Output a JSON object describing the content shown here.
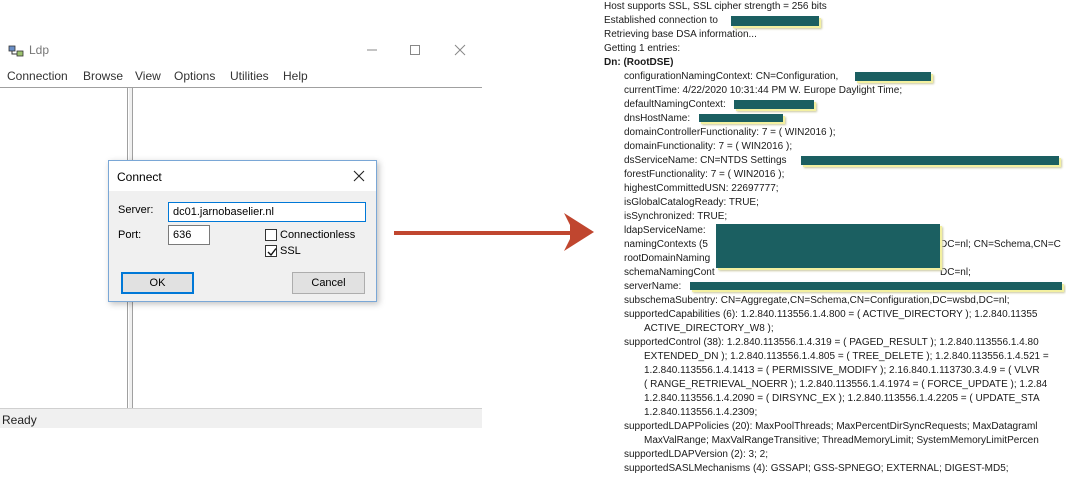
{
  "window": {
    "title": "Ldp",
    "menu": [
      "Connection",
      "Browse",
      "View",
      "Options",
      "Utilities",
      "Help"
    ],
    "status": "Ready"
  },
  "dialog": {
    "title": "Connect",
    "server_label": "Server:",
    "server_value": "dc01.jarnobaselier.nl",
    "port_label": "Port:",
    "port_value": "636",
    "connectionless_label": "Connectionless",
    "connectionless_checked": false,
    "ssl_label": "SSL",
    "ssl_checked": true,
    "ok_label": "OK",
    "cancel_label": "Cancel"
  },
  "arrow": {
    "color": "#c0462f"
  },
  "redaction_color": "#1b5f61",
  "output": {
    "lines": [
      "Host supports SSL, SSL cipher strength = 256 bits",
      "Established connection to",
      "Retrieving base DSA information...",
      "Getting 1 entries:",
      "Dn: (RootDSE)",
      "configurationNamingContext: CN=Configuration,",
      "currentTime: 4/22/2020 10:31:44 PM W. Europe Daylight Time;",
      "defaultNamingContext:",
      "dnsHostName:",
      "domainControllerFunctionality: 7 = ( WIN2016 );",
      "domainFunctionality: 7 = ( WIN2016 );",
      "dsServiceName: CN=NTDS Settings",
      "forestFunctionality: 7 = ( WIN2016 );",
      "highestCommittedUSN: 22697777;",
      "isGlobalCatalogReady: TRUE;",
      "isSynchronized: TRUE;",
      "ldapServiceName:",
      "namingContexts (5",
      "rootDomainNaming",
      "schemaNamingCont",
      "serverName:",
      "subschemaSubentry: CN=Aggregate,CN=Schema,CN=Configuration,DC=wsbd,DC=nl;",
      "supportedCapabilities (6): 1.2.840.113556.1.4.800 = ( ACTIVE_DIRECTORY ); 1.2.840.11355",
      "ACTIVE_DIRECTORY_W8 );",
      "supportedControl (38): 1.2.840.113556.1.4.319 = ( PAGED_RESULT ); 1.2.840.113556.1.4.80",
      "EXTENDED_DN ); 1.2.840.113556.1.4.805 = ( TREE_DELETE ); 1.2.840.113556.1.4.521 =",
      "1.2.840.113556.1.4.1413 = ( PERMISSIVE_MODIFY ); 2.16.840.1.113730.3.4.9 = ( VLVR",
      "( RANGE_RETRIEVAL_NOERR ); 1.2.840.113556.1.4.1974 = ( FORCE_UPDATE ); 1.2.84",
      "1.2.840.113556.1.4.2090 = ( DIRSYNC_EX ); 1.2.840.113556.1.4.2205 = ( UPDATE_STA",
      "1.2.840.113556.1.4.2309;",
      "supportedLDAPPolicies (20): MaxPoolThreads; MaxPercentDirSyncRequests; MaxDatagraml",
      "MaxValRange; MaxValRangeTransitive; ThreadMemoryLimit; SystemMemoryLimitPercen",
      "supportedLDAPVersion (2): 3; 2;",
      "supportedSASLMechanisms (4): GSSAPI; GSS-SPNEGO; EXTERNAL; DIGEST-MD5;"
    ],
    "trailing": {
      "naming_contexts_tail": "DC=nl; CN=Schema,CN=C",
      "schema_naming_tail": "DC=nl;"
    }
  }
}
